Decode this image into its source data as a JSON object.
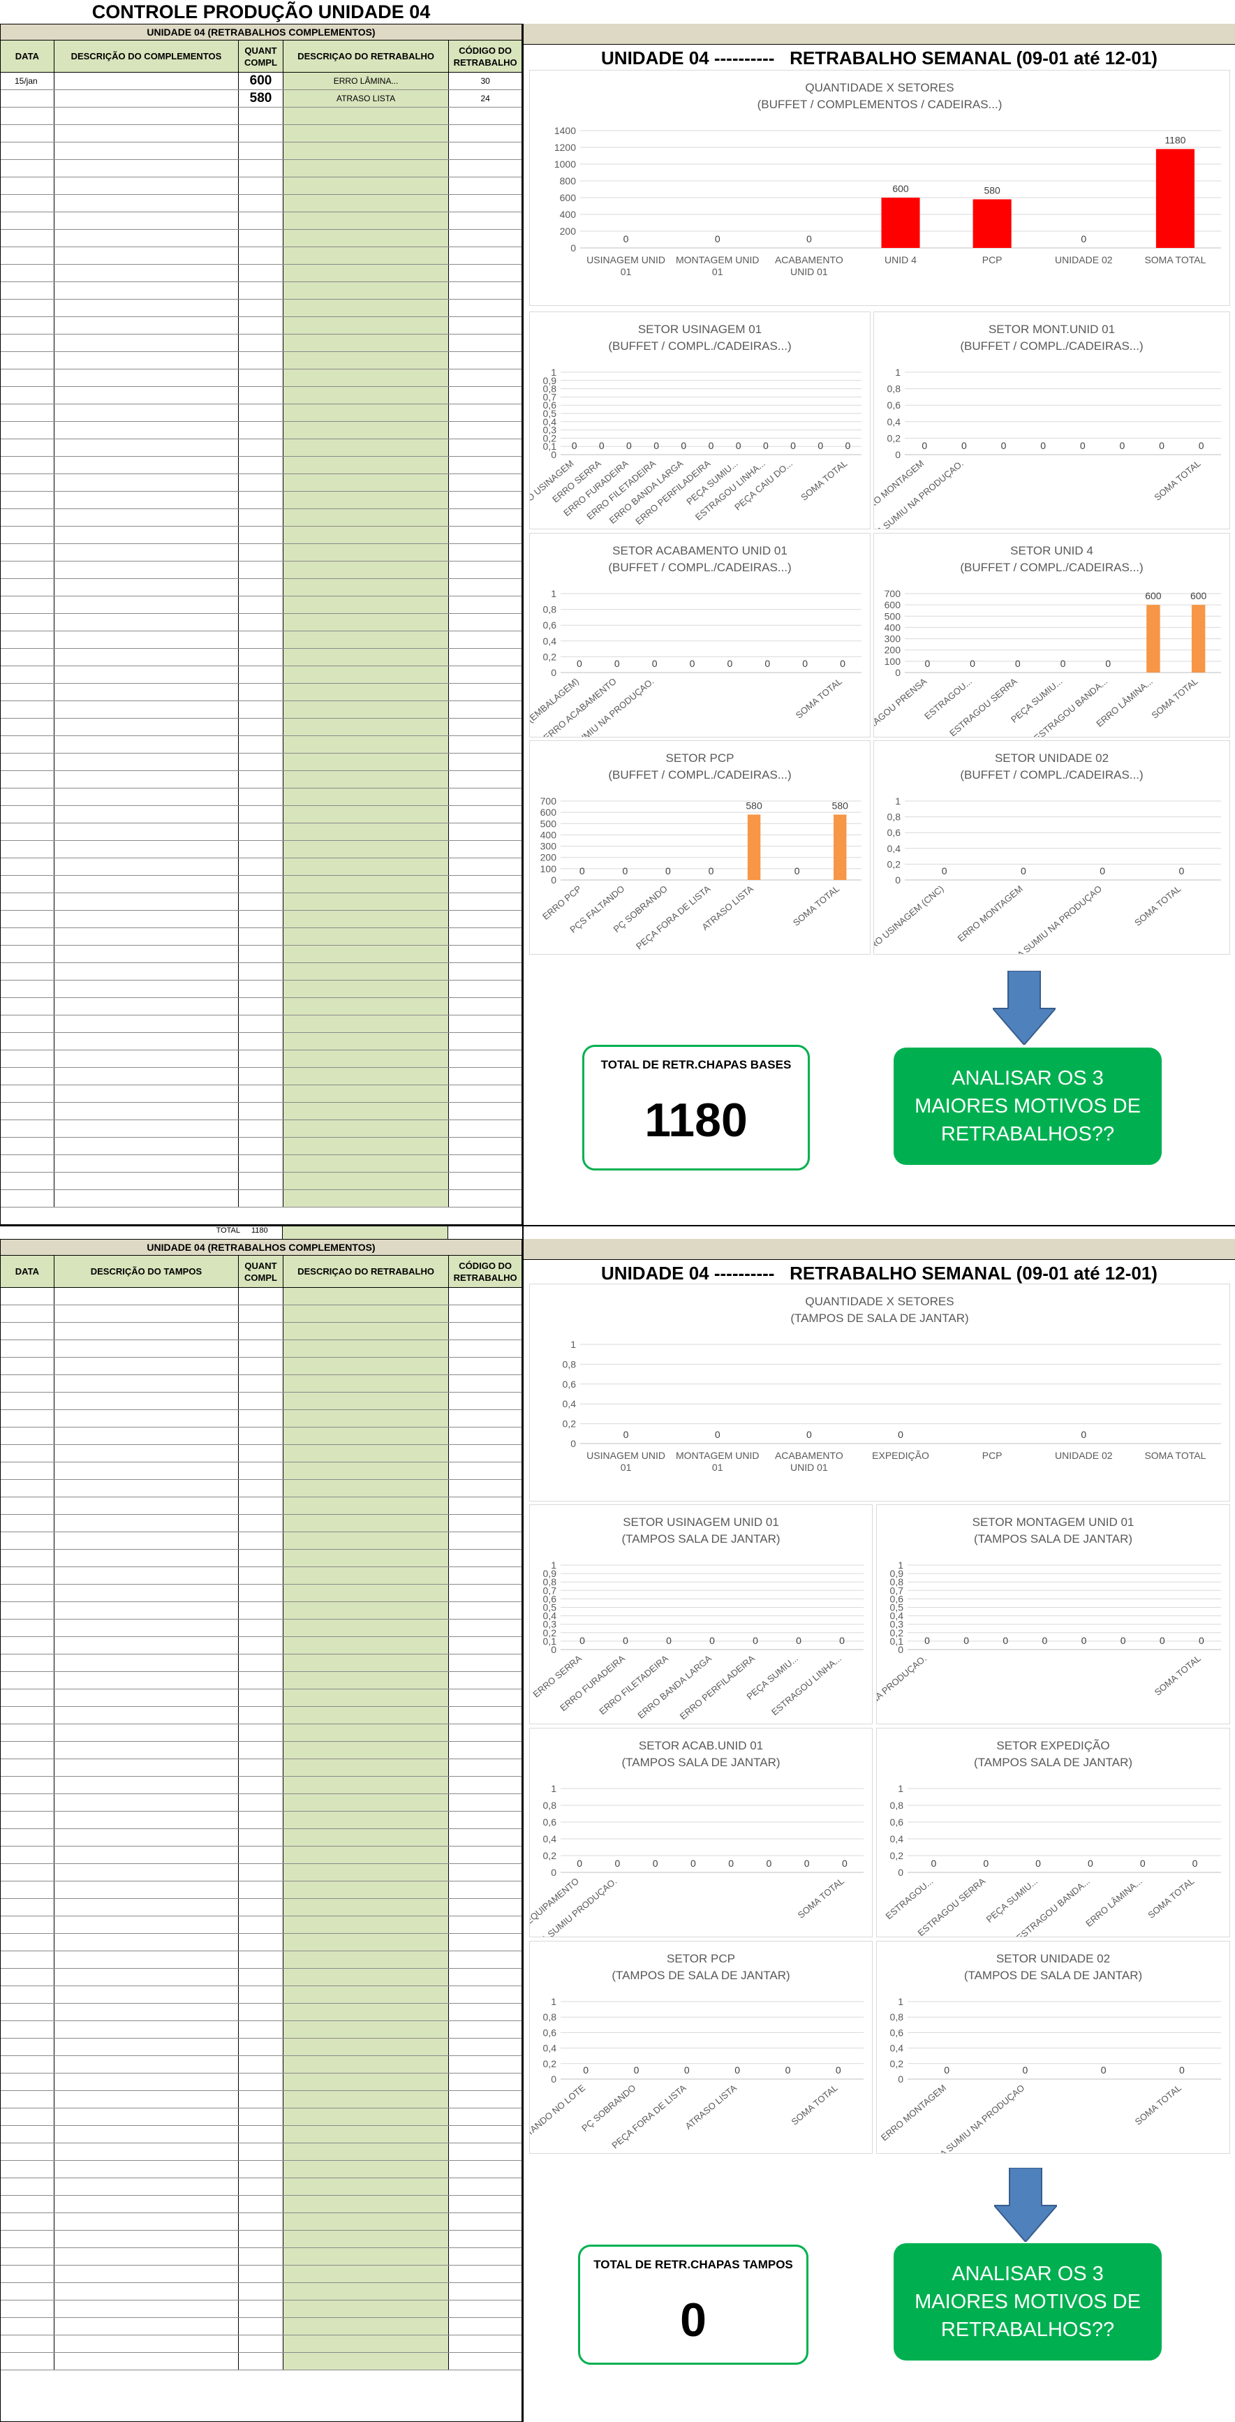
{
  "page_title": "CONTROLE PRODUÇÃO UNIDADE 04",
  "section1": {
    "header": "UNIDADE 04 (RETRABALHOS COMPLEMENTOS)",
    "columns": [
      "DATA",
      "DESCRIÇÃO DO COMPLEMENTOS",
      "QUANT COMPL",
      "DESCRIÇAO DO RETRABALHO",
      "CÓDIGO DO RETRABALHO"
    ],
    "rows": [
      {
        "date": "15/jan",
        "desc": "",
        "qty": "600",
        "rework": "ERRO LÂMINA...",
        "code": "30"
      },
      {
        "date": "",
        "desc": "",
        "qty": "580",
        "rework": "ATRASO LISTA",
        "code": "24"
      }
    ],
    "total_label": "TOTAL",
    "total_value": "1180"
  },
  "section2": {
    "header": "UNIDADE 04 (RETRABALHOS COMPLEMENTOS)",
    "columns": [
      "DATA",
      "DESCRIÇÃO DO TAMPOS",
      "QUANT COMPL",
      "DESCRIÇAO DO RETRABALHO",
      "CÓDIGO DO RETRABALHO"
    ]
  },
  "dash1": {
    "title": "UNIDADE 04 ----------   RETRABALHO SEMANAL (09-01 até 12-01)",
    "total_label": "TOTAL DE RETR.CHAPAS BASES",
    "total_value": "1180",
    "action": "ANALISAR OS 3 MAIORES MOTIVOS DE RETRABALHOS??"
  },
  "dash2": {
    "title": "UNIDADE 04 ----------   RETRABALHO SEMANAL (09-01 até 12-01)",
    "total_label": "TOTAL DE RETR.CHAPAS TAMPOS",
    "total_value": "0",
    "action": "ANALISAR OS 3 MAIORES MOTIVOS DE RETRABALHOS??"
  },
  "colors": {
    "red_bar": "#ff0000",
    "orange_bar": "#f79646",
    "green": "#00b050",
    "arrow": "#4f81bd",
    "header_tan": "#ddd9c4",
    "col_green": "#d8e4bc"
  },
  "chart_data": [
    {
      "id": "c1",
      "type": "bar",
      "title": "QUANTIDADE X SETORES",
      "subtitle": "(BUFFET / COMPLEMENTOS / CADEIRAS...)",
      "categories": [
        "USINAGEM UNID 01",
        "MONTAGEM UNID 01",
        "ACABAMENTO UNID 01",
        "UNID 4",
        "PCP",
        "UNIDADE 02",
        "SOMA TOTAL"
      ],
      "values": [
        0,
        0,
        0,
        600,
        580,
        0,
        1180
      ],
      "ylim": [
        0,
        1400
      ],
      "yticks": [
        0,
        200,
        400,
        600,
        800,
        1000,
        1200,
        1400
      ],
      "color": "#ff0000",
      "grid": true
    },
    {
      "id": "c2",
      "type": "bar",
      "title": "SETOR USINAGEM 01",
      "subtitle": "(BUFFET / COMPL./CADEIRAS...)",
      "categories": [
        "ERRO USINAGEM",
        "ERRO SERRA",
        "ERRO FURADEIRA",
        "ERRO FILETADEIRA",
        "ERRO BANDA LARGA",
        "ERRO PERFILADEIRA",
        "PEÇA SUMIU...",
        "ESTRAGOU LINHA...",
        "PEÇA CAIU DO...",
        "",
        "SOMA TOTAL"
      ],
      "values": [
        0,
        0,
        0,
        0,
        0,
        0,
        0,
        0,
        0,
        0,
        0
      ],
      "ylim": [
        0,
        1
      ],
      "yticks": [
        "0",
        "0,1",
        "0,2",
        "0,3",
        "0,4",
        "0,5",
        "0,6",
        "0,7",
        "0,8",
        "0,9",
        "1"
      ],
      "color": "#f79646",
      "grid": true
    },
    {
      "id": "c3",
      "type": "bar",
      "title": "SETOR  MONT.UNID 01",
      "subtitle": "(BUFFET / COMPL./CADEIRAS...)",
      "categories": [
        "ERRO MONTAGEM",
        "PEÇA SUMIU NA PRODUÇAO.",
        "",
        "",
        "",
        "",
        "",
        "SOMA TOTAL"
      ],
      "values": [
        0,
        0,
        0,
        0,
        0,
        0,
        0,
        0
      ],
      "ylim": [
        0,
        1
      ],
      "yticks": [
        "0",
        "0,2",
        "0,4",
        "0,6",
        "0,8",
        "1"
      ],
      "color": "#f79646",
      "grid": true
    },
    {
      "id": "c4",
      "type": "bar",
      "title": "SETOR ACABAMENTO UNID 01",
      "subtitle": "(BUFFET / COMPL./CADEIRAS...)",
      "categories": [
        "PÇ CAIU (EMBALAGEM)",
        "ERRO ACABAMENTO",
        "PEÇA SUMIU NA PRODUÇAO.",
        "",
        "",
        "",
        "",
        "SOMA TOTAL"
      ],
      "values": [
        0,
        0,
        0,
        0,
        0,
        0,
        0,
        0
      ],
      "ylim": [
        0,
        1
      ],
      "yticks": [
        "0",
        "0,2",
        "0,4",
        "0,6",
        "0,8",
        "1"
      ],
      "color": "#f79646",
      "grid": true
    },
    {
      "id": "c5",
      "type": "bar",
      "title": "SETOR UNID 4",
      "subtitle": "(BUFFET / COMPL./CADEIRAS...)",
      "categories": [
        "ESTRAGOU PRENSA",
        "ESTRAGOU...",
        "ESTRAGOU SERRA",
        "PEÇA SUMIU...",
        "ESTRAGOU BANDA...",
        "ERRO LÂMINA...",
        "SOMA TOTAL"
      ],
      "values": [
        0,
        0,
        0,
        0,
        0,
        600,
        600
      ],
      "ylim": [
        0,
        700
      ],
      "yticks": [
        0,
        100,
        200,
        300,
        400,
        500,
        600,
        700
      ],
      "color": "#f79646",
      "grid": true
    },
    {
      "id": "c6",
      "type": "bar",
      "title": "SETOR PCP",
      "subtitle": "(BUFFET / COMPL./CADEIRAS...)",
      "categories": [
        "ERRO PCP",
        "PÇS FALTANDO",
        "PÇ SOBRANDO",
        "PEÇA FORA DE LISTA",
        "ATRASO LISTA",
        "",
        "SOMA TOTAL"
      ],
      "values": [
        0,
        0,
        0,
        0,
        580,
        0,
        580
      ],
      "ylim": [
        0,
        700
      ],
      "yticks": [
        0,
        100,
        200,
        300,
        400,
        500,
        600,
        700
      ],
      "color": "#f79646",
      "grid": true
    },
    {
      "id": "c7",
      "type": "bar",
      "title": "SETOR  UNIDADE 02",
      "subtitle": "(BUFFET / COMPL./CADEIRAS...)",
      "categories": [
        "ERRO USINAGEM (CNC)",
        "ERRO MONTAGEM",
        "PEÇA SUMIU NA PRODUÇAO",
        "SOMA TOTAL"
      ],
      "values": [
        0,
        0,
        0,
        0
      ],
      "ylim": [
        0,
        1
      ],
      "yticks": [
        "0",
        "0,2",
        "0,4",
        "0,6",
        "0,8",
        "1"
      ],
      "color": "#f79646",
      "grid": true
    },
    {
      "id": "c8",
      "type": "bar",
      "title": "QUANTIDADE X SETORES",
      "subtitle": "(TAMPOS DE SALA DE JANTAR)",
      "categories": [
        "USINAGEM UNID 01",
        "MONTAGEM UNID 01",
        "ACABAMENTO UNID 01",
        "EXPEDIÇÃO",
        "PCP",
        "UNIDADE 02",
        "SOMA TOTAL"
      ],
      "values": [
        0,
        0,
        0,
        0,
        null,
        0,
        null
      ],
      "ylim": [
        0,
        1
      ],
      "yticks": [
        "0",
        "0,2",
        "0,4",
        "0,6",
        "0,8",
        "1"
      ],
      "color": "#ff0000",
      "grid": true
    },
    {
      "id": "c9",
      "type": "bar",
      "title": "SETOR USINAGEM  UNID 01",
      "subtitle": "(TAMPOS SALA DE JANTAR)",
      "categories": [
        "ERRO SERRA",
        "ERRO FURADEIRA",
        "ERRO FILETADEIRA",
        "ERRO BANDA LARGA",
        "ERRO PERFILADEIRA",
        "PEÇA SUMIU...",
        "ESTRAGOU LINHA..."
      ],
      "values": [
        0,
        0,
        0,
        0,
        0,
        0,
        0
      ],
      "ylim": [
        0,
        1
      ],
      "yticks": [
        "0",
        "0,1",
        "0,2",
        "0,3",
        "0,4",
        "0,5",
        "0,6",
        "0,7",
        "0,8",
        "0,9",
        "1"
      ],
      "color": "#f79646",
      "grid": true
    },
    {
      "id": "c10",
      "type": "bar",
      "title": "SETOR  MONTAGEM UNID 01",
      "subtitle": "(TAMPOS SALA DE JANTAR)",
      "categories": [
        "PEÇA SUMIU NA PRODUÇAO.",
        "",
        "",
        "",
        "",
        "",
        "",
        "SOMA TOTAL"
      ],
      "values": [
        0,
        0,
        0,
        0,
        0,
        0,
        0,
        0
      ],
      "ylim": [
        0,
        1
      ],
      "yticks": [
        "0",
        "0,1",
        "0,2",
        "0,3",
        "0,4",
        "0,5",
        "0,6",
        "0,7",
        "0,8",
        "0,9",
        "1"
      ],
      "color": "#f79646",
      "grid": true
    },
    {
      "id": "c11",
      "type": "bar",
      "title": "SETOR ACAB.UNID 01",
      "subtitle": "(TAMPOS SALA DE JANTAR)",
      "categories": [
        "FURADA EQUIPAMENTO",
        "PEÇA SUMIU PRODUÇAO.",
        "",
        "",
        "",
        "",
        "",
        "SOMA TOTAL"
      ],
      "values": [
        0,
        0,
        0,
        0,
        0,
        0,
        0,
        0
      ],
      "ylim": [
        0,
        1
      ],
      "yticks": [
        "0",
        "0,2",
        "0,4",
        "0,6",
        "0,8",
        "1"
      ],
      "color": "#f79646",
      "grid": true
    },
    {
      "id": "c12",
      "type": "bar",
      "title": "SETOR EXPEDIÇÃO",
      "subtitle": "(TAMPOS SALA DE JANTAR)",
      "categories": [
        "ESTRAGOU...",
        "ESTRAGOU SERRA",
        "PEÇA SUMIU...",
        "ESTRAGOU BANDA...",
        "ERRO LÂMINA...",
        "SOMA TOTAL"
      ],
      "values": [
        0,
        0,
        0,
        0,
        0,
        0
      ],
      "ylim": [
        0,
        1
      ],
      "yticks": [
        "0",
        "0,2",
        "0,4",
        "0,6",
        "0,8",
        "1"
      ],
      "color": "#f79646",
      "grid": true
    },
    {
      "id": "c13",
      "type": "bar",
      "title": "SETOR  PCP",
      "subtitle": "(TAMPOS DE SALA DE JANTAR)",
      "categories": [
        "PÇS FALTANDO NO LOTE",
        "PÇ SOBRANDO",
        "PEÇA FORA DE LISTA",
        "ATRASO LISTA",
        "",
        "SOMA TOTAL"
      ],
      "values": [
        0,
        0,
        0,
        0,
        0,
        0
      ],
      "ylim": [
        0,
        1
      ],
      "yticks": [
        "0",
        "0,2",
        "0,4",
        "0,6",
        "0,8",
        "1"
      ],
      "color": "#f79646",
      "grid": true
    },
    {
      "id": "c14",
      "type": "bar",
      "title": "SETOR  UNIDADE 02",
      "subtitle": "(TAMPOS DE SALA DE JANTAR)",
      "categories": [
        "ERRO MONTAGEM",
        "PEÇA SUMIU NA PRODUÇAO",
        "",
        "SOMA TOTAL"
      ],
      "values": [
        0,
        0,
        0,
        0
      ],
      "ylim": [
        0,
        1
      ],
      "yticks": [
        "0",
        "0,2",
        "0,4",
        "0,6",
        "0,8",
        "1"
      ],
      "color": "#f79646",
      "grid": true
    }
  ]
}
